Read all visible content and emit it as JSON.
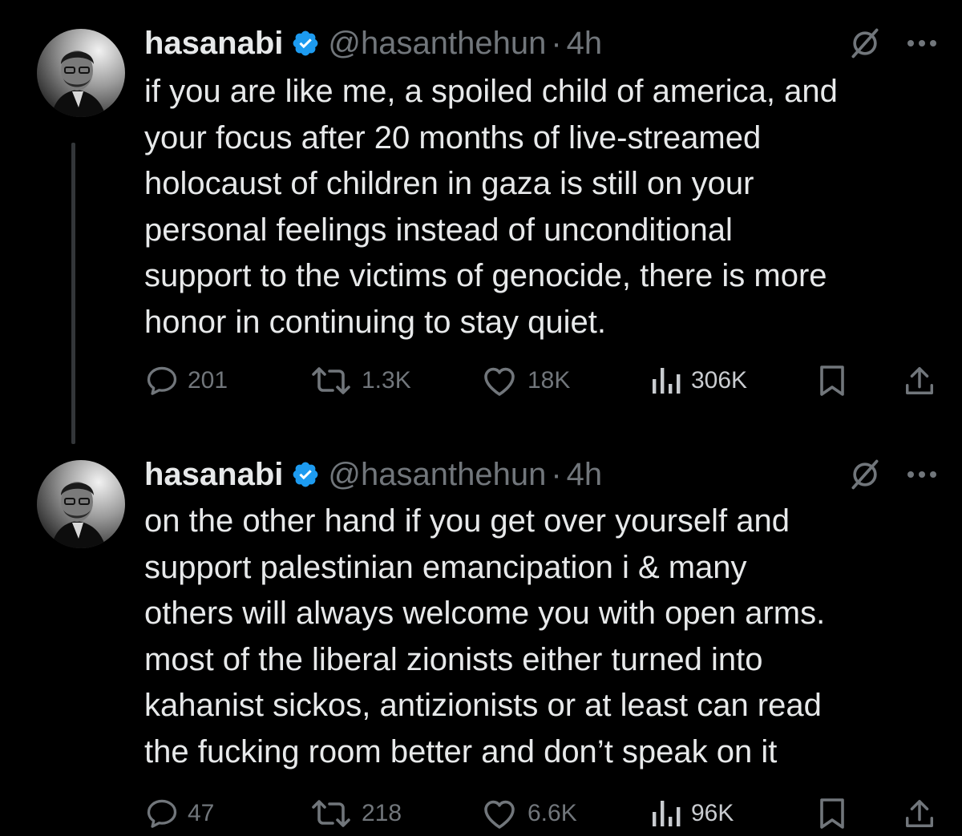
{
  "colors": {
    "background": "#000000",
    "text_primary": "#e7e9ea",
    "text_secondary": "#71767b",
    "verified_badge": "#1d9bf0",
    "thread_line": "#333639"
  },
  "tweets": [
    {
      "author": {
        "name": "hasanabi",
        "handle": "@hasanthehun",
        "verified": true,
        "avatar_icon": "avatar-photo"
      },
      "separator": "·",
      "time": "4h",
      "grok_icon": "grok-icon",
      "more_icon": "more-dots-icon",
      "lines": [
        "if you are like me, a spoiled child of america, and",
        "your focus after 20 months of live-streamed",
        "holocaust of children in gaza is still on your",
        "personal feelings instead of unconditional",
        "support to the victims of genocide, there is more",
        "honor in continuing to stay quiet."
      ],
      "stats": {
        "replies": "201",
        "reposts": "1.3K",
        "likes": "18K",
        "views": "306K"
      }
    },
    {
      "author": {
        "name": "hasanabi",
        "handle": "@hasanthehun",
        "verified": true,
        "avatar_icon": "avatar-photo"
      },
      "separator": "·",
      "time": "4h",
      "grok_icon": "grok-icon",
      "more_icon": "more-dots-icon",
      "lines": [
        "on the other hand if you get over yourself and",
        "support palestinian emancipation i & many",
        "others will always welcome you with open arms.",
        "most of the liberal zionists either turned into",
        "kahanist sickos, antizionists or at least can read",
        "the fucking room better and don’t speak on it"
      ],
      "stats": {
        "replies": "47",
        "reposts": "218",
        "likes": "6.6K",
        "views": "96K"
      }
    }
  ]
}
